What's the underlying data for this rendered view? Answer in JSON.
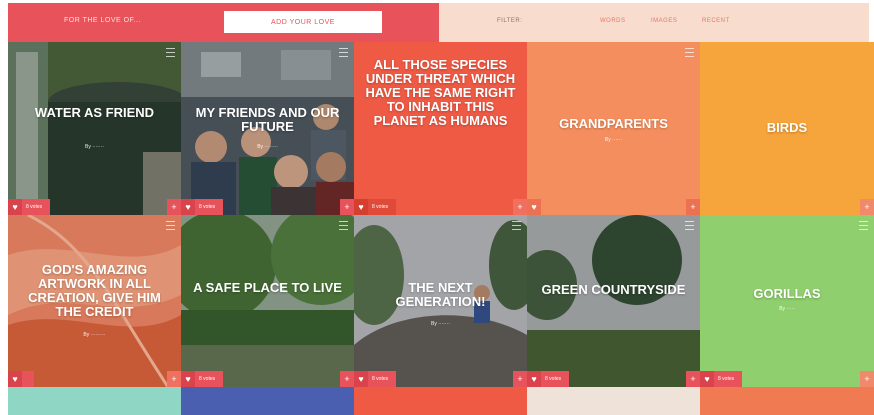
{
  "header": {
    "brand": "FOR THE LOVE OF...",
    "add_label": "ADD YOUR LOVE",
    "filter_label": "FILTER:",
    "filters": [
      "WORDS",
      "IMAGES",
      "RECENT"
    ]
  },
  "tiles": [
    {
      "title": "WATER AS FRIEND",
      "by": "By ·······",
      "votes": "8 votes",
      "image": "photo-water-tank"
    },
    {
      "title": "MY FRIENDS AND OUR FUTURE",
      "by": "By ········",
      "votes": "8 votes",
      "image": "photo-group-of-friends"
    },
    {
      "title": "ALL THOSE SPECIES UNDER THREAT WHICH HAVE THE SAME RIGHT TO INHABIT THIS PLANET AS HUMANS",
      "by": "",
      "votes": "8 votes",
      "image": ""
    },
    {
      "title": "GRANDPARENTS",
      "by": "By ······",
      "votes": "",
      "image": ""
    },
    {
      "title": "BIRDS",
      "by": "",
      "votes": "",
      "image": ""
    },
    {
      "title": "GOD'S AMAZING ARTWORK IN ALL CREATION, GIVE HIM THE CREDIT",
      "by": "By ·········",
      "votes": "",
      "image": "photo-feather-closeup"
    },
    {
      "title": "A SAFE PLACE TO LIVE",
      "by": "",
      "votes": "8 votes",
      "image": "photo-riverbank"
    },
    {
      "title": "THE NEXT GENERATION!",
      "by": "By ·······",
      "votes": "8 votes",
      "image": "photo-child-on-rock"
    },
    {
      "title": "GREEN COUNTRYSIDE",
      "by": "",
      "votes": "8 votes",
      "image": "photo-countryside"
    },
    {
      "title": "GORILLAS",
      "by": "By ·····",
      "votes": "8 votes",
      "image": ""
    }
  ],
  "colors": {
    "coral": "#e8525a",
    "peach": "#f8dccd",
    "orange_red": "#ef5a44",
    "salmon": "#f48e5e",
    "orange": "#f6a43c",
    "green": "#8fcf6e",
    "teal": "#8fd6c4",
    "indigo": "#4b5fb0"
  }
}
